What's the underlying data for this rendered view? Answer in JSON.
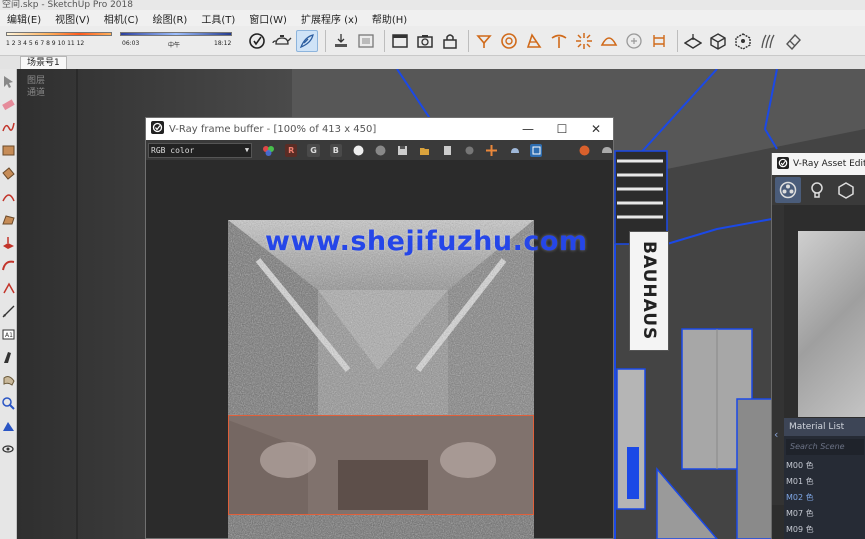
{
  "app": {
    "title": "空间.skp - SketchUp Pro 2018"
  },
  "menubar": {
    "items": [
      "编辑(E)",
      "视图(V)",
      "相机(C)",
      "绘图(R)",
      "工具(T)",
      "窗口(W)",
      "扩展程序 (x)",
      "帮助(H)"
    ]
  },
  "shadow_toolbar": {
    "hours": "1 2 3 4 5 6 7 8 9 10 11 12",
    "time_start": "06:03",
    "time_mid": "中午",
    "time_end": "18:12"
  },
  "toolbar_icons": {
    "group1": [
      "styles-icon",
      "teapot-icon",
      "paint-icon"
    ],
    "group2": [
      "section-icon",
      "display-icon"
    ],
    "group3": [
      "window-icon",
      "camera-icon",
      "lock-icon"
    ],
    "group4": [
      "spot-light-icon",
      "sphere-light-icon",
      "rect-light-icon",
      "ies-light-icon",
      "omni-light-icon",
      "dome-light-icon",
      "fur-icon",
      "mesh-icon"
    ],
    "group5": [
      "plane-icon",
      "box-icon",
      "proxy-icon",
      "fur-strands-icon",
      "eraser-icon"
    ]
  },
  "scene": {
    "tab_label": "场景号1"
  },
  "viewport": {
    "layer_label_1": "图层",
    "layer_label_2": "通道",
    "sign_text": "BAUHAUS"
  },
  "frame_buffer": {
    "title": "V-Ray frame buffer - [100% of 413 x 450]",
    "channel": "RGB color",
    "btn_r": "R",
    "btn_g": "G",
    "btn_b": "B",
    "minimize": "—",
    "maximize": "☐",
    "close": "✕"
  },
  "asset_editor": {
    "title": "V-Ray Asset Edit",
    "material_list_label": "Material List",
    "search_placeholder": "Search Scene",
    "materials": [
      "M00 色",
      "M01 色",
      "M02 色",
      "M07 色",
      "M09 色"
    ],
    "selected_index": 2
  },
  "watermark": {
    "text": "www.shejifuzhu.com"
  },
  "colors": {
    "accent_blue": "#2546e8",
    "region_orange": "#e0603b",
    "scene_line_blue": "#1b49e6"
  }
}
